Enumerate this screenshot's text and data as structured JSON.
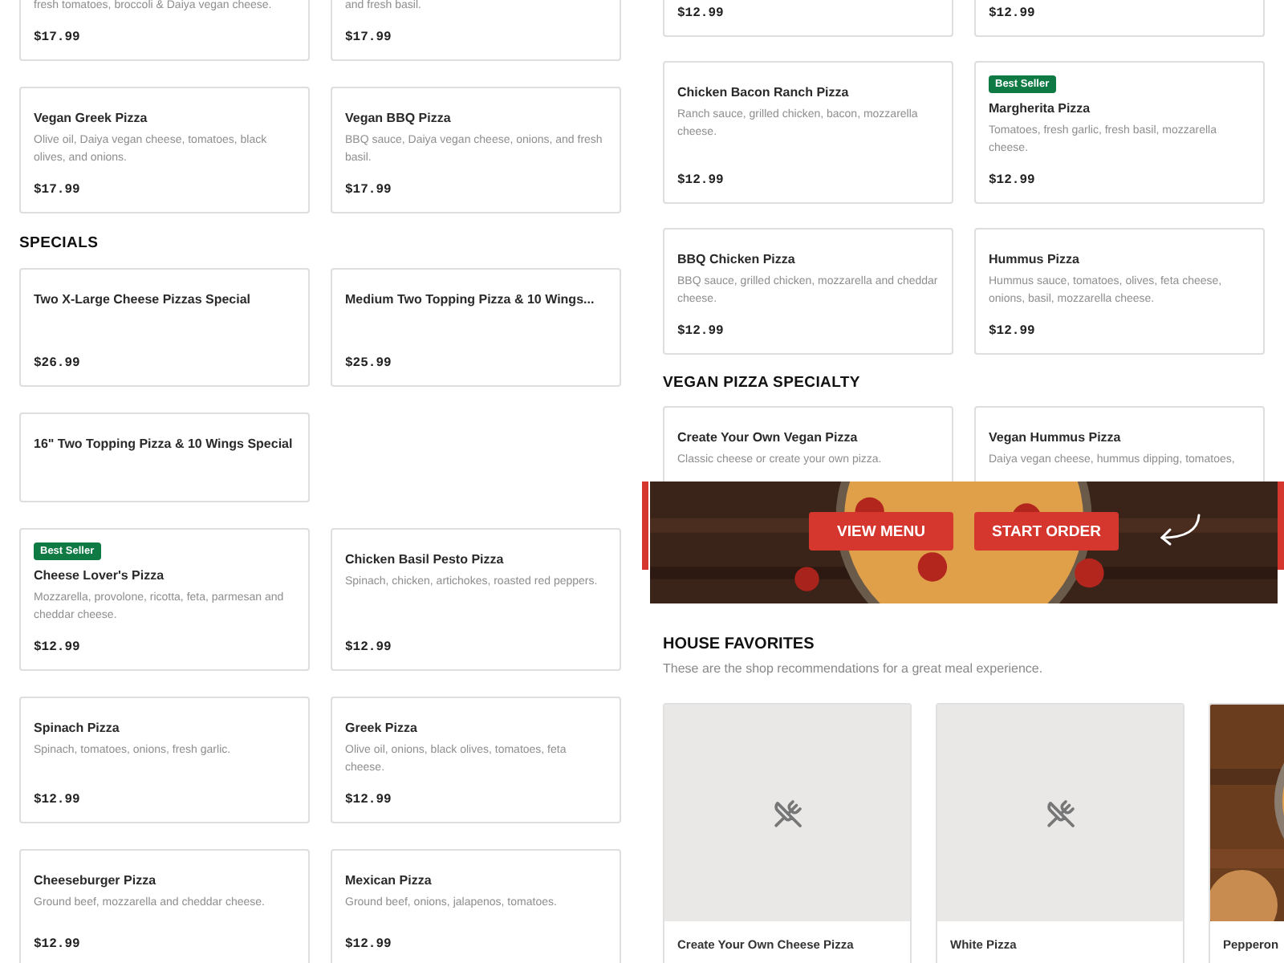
{
  "left_column": [
    {
      "kind": "cards",
      "cards": [
        {
          "description": "fresh tomatoes, broccoli & Daiya vegan cheese.",
          "price": "$17.99"
        },
        {
          "description": "and fresh basil.",
          "price": "$17.99"
        }
      ]
    },
    {
      "kind": "cards",
      "cards": [
        {
          "name": "Vegan Greek Pizza",
          "description": "Olive oil, Daiya vegan cheese, tomatoes, black olives, and onions.",
          "price": "$17.99"
        },
        {
          "name": "Vegan BBQ Pizza",
          "description": "BBQ sauce, Daiya vegan cheese, onions, and fresh basil.",
          "price": "$17.99"
        }
      ]
    },
    {
      "kind": "heading",
      "text": "SPECIALS"
    },
    {
      "kind": "cards",
      "cards": [
        {
          "name": "Two X-Large Cheese Pizzas Special",
          "price": "$26.99"
        },
        {
          "name": "Medium Two Topping Pizza & 10 Wings...",
          "price": "$25.99"
        }
      ]
    },
    {
      "kind": "cards",
      "cards": [
        {
          "name": "16\" Two Topping Pizza & 10 Wings Special"
        }
      ]
    },
    {
      "kind": "cards",
      "cards": [
        {
          "badge": "Best Seller",
          "name": "Cheese Lover's Pizza",
          "description": "Mozzarella, provolone, ricotta, feta, parmesan and cheddar cheese.",
          "price": "$12.99"
        },
        {
          "name": "Chicken Basil Pesto Pizza",
          "description": "Spinach, chicken, artichokes, roasted red peppers.",
          "price": "$12.99"
        }
      ]
    },
    {
      "kind": "cards",
      "cards": [
        {
          "name": "Spinach Pizza",
          "description": "Spinach, tomatoes, onions, fresh garlic.",
          "price": "$12.99"
        },
        {
          "name": "Greek Pizza",
          "description": "Olive oil, onions, black olives, tomatoes, feta cheese.",
          "price": "$12.99"
        }
      ]
    },
    {
      "kind": "cards",
      "cards": [
        {
          "name": "Cheeseburger Pizza",
          "description": "Ground beef, mozzarella and cheddar cheese.",
          "price": "$12.99"
        },
        {
          "name": "Mexican Pizza",
          "description": "Ground beef, onions, jalapenos, tomatoes.",
          "price": "$12.99"
        }
      ]
    }
  ],
  "right_column": [
    {
      "kind": "cards",
      "cards": [
        {
          "price": "$12.99"
        },
        {
          "price": "$12.99"
        }
      ]
    },
    {
      "kind": "cards",
      "cards": [
        {
          "name": "Chicken Bacon Ranch Pizza",
          "description": "Ranch sauce, grilled chicken, bacon, mozzarella cheese.",
          "price": "$12.99"
        },
        {
          "badge": "Best Seller",
          "name": "Margherita Pizza",
          "description": "Tomatoes, fresh garlic, fresh basil, mozzarella cheese.",
          "price": "$12.99"
        }
      ]
    },
    {
      "kind": "cards",
      "cards": [
        {
          "name": "BBQ Chicken Pizza",
          "description": "BBQ sauce, grilled chicken, mozzarella and cheddar cheese.",
          "price": "$12.99"
        },
        {
          "name": "Hummus Pizza",
          "description": "Hummus sauce, tomatoes, olives, feta cheese, onions, basil, mozzarella cheese.",
          "price": "$12.99"
        }
      ]
    },
    {
      "kind": "heading",
      "text": "VEGAN PIZZA SPECIALTY"
    },
    {
      "kind": "cards",
      "cards": [
        {
          "name": "Create Your Own Vegan Pizza",
          "description": "Classic cheese or create your own pizza."
        },
        {
          "name": "Vegan Hummus Pizza",
          "description": "Daiya vegan cheese, hummus dipping, tomatoes,"
        }
      ]
    }
  ],
  "banner": {
    "buttons": [
      "VIEW MENU",
      "START ORDER"
    ]
  },
  "house_favorites": {
    "title": "HOUSE FAVORITES",
    "subtitle": "These are the shop recommendations for a great meal experience.",
    "items": [
      {
        "name": "Create Your Own Cheese Pizza",
        "has_photo": false
      },
      {
        "name": "White Pizza",
        "has_photo": false
      },
      {
        "name": "Pepperon",
        "has_photo": true
      }
    ]
  }
}
